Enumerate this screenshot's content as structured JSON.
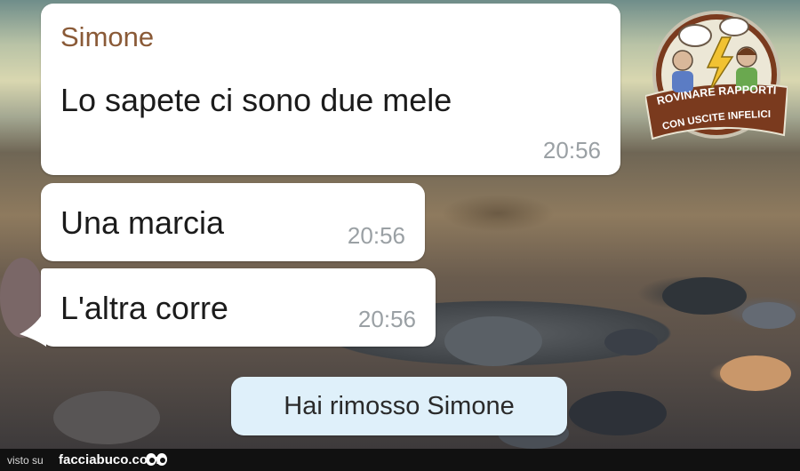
{
  "conversation": {
    "messages": [
      {
        "sender": "Simone",
        "text": "Lo sapete ci sono due mele",
        "time": "20:56"
      },
      {
        "text": "Una marcia",
        "time": "20:56"
      },
      {
        "text": "L'altra corre",
        "time": "20:56"
      }
    ],
    "system_notice": "Hai rimosso Simone"
  },
  "watermark": {
    "line1": "ROVINARE RAPPORTI",
    "line2": "CON USCITE INFELICI"
  },
  "footer": {
    "visto_su": "visto su",
    "site": "facciabuco.com"
  },
  "colors": {
    "bubble": "#ffffff",
    "sender_name": "#8a5a37",
    "system_bubble": "#dff0fa",
    "timestamp": "#9aa0a4",
    "logo_fill": "#7a3a1e"
  },
  "icons": [
    "people-logo",
    "eyes-icon"
  ]
}
